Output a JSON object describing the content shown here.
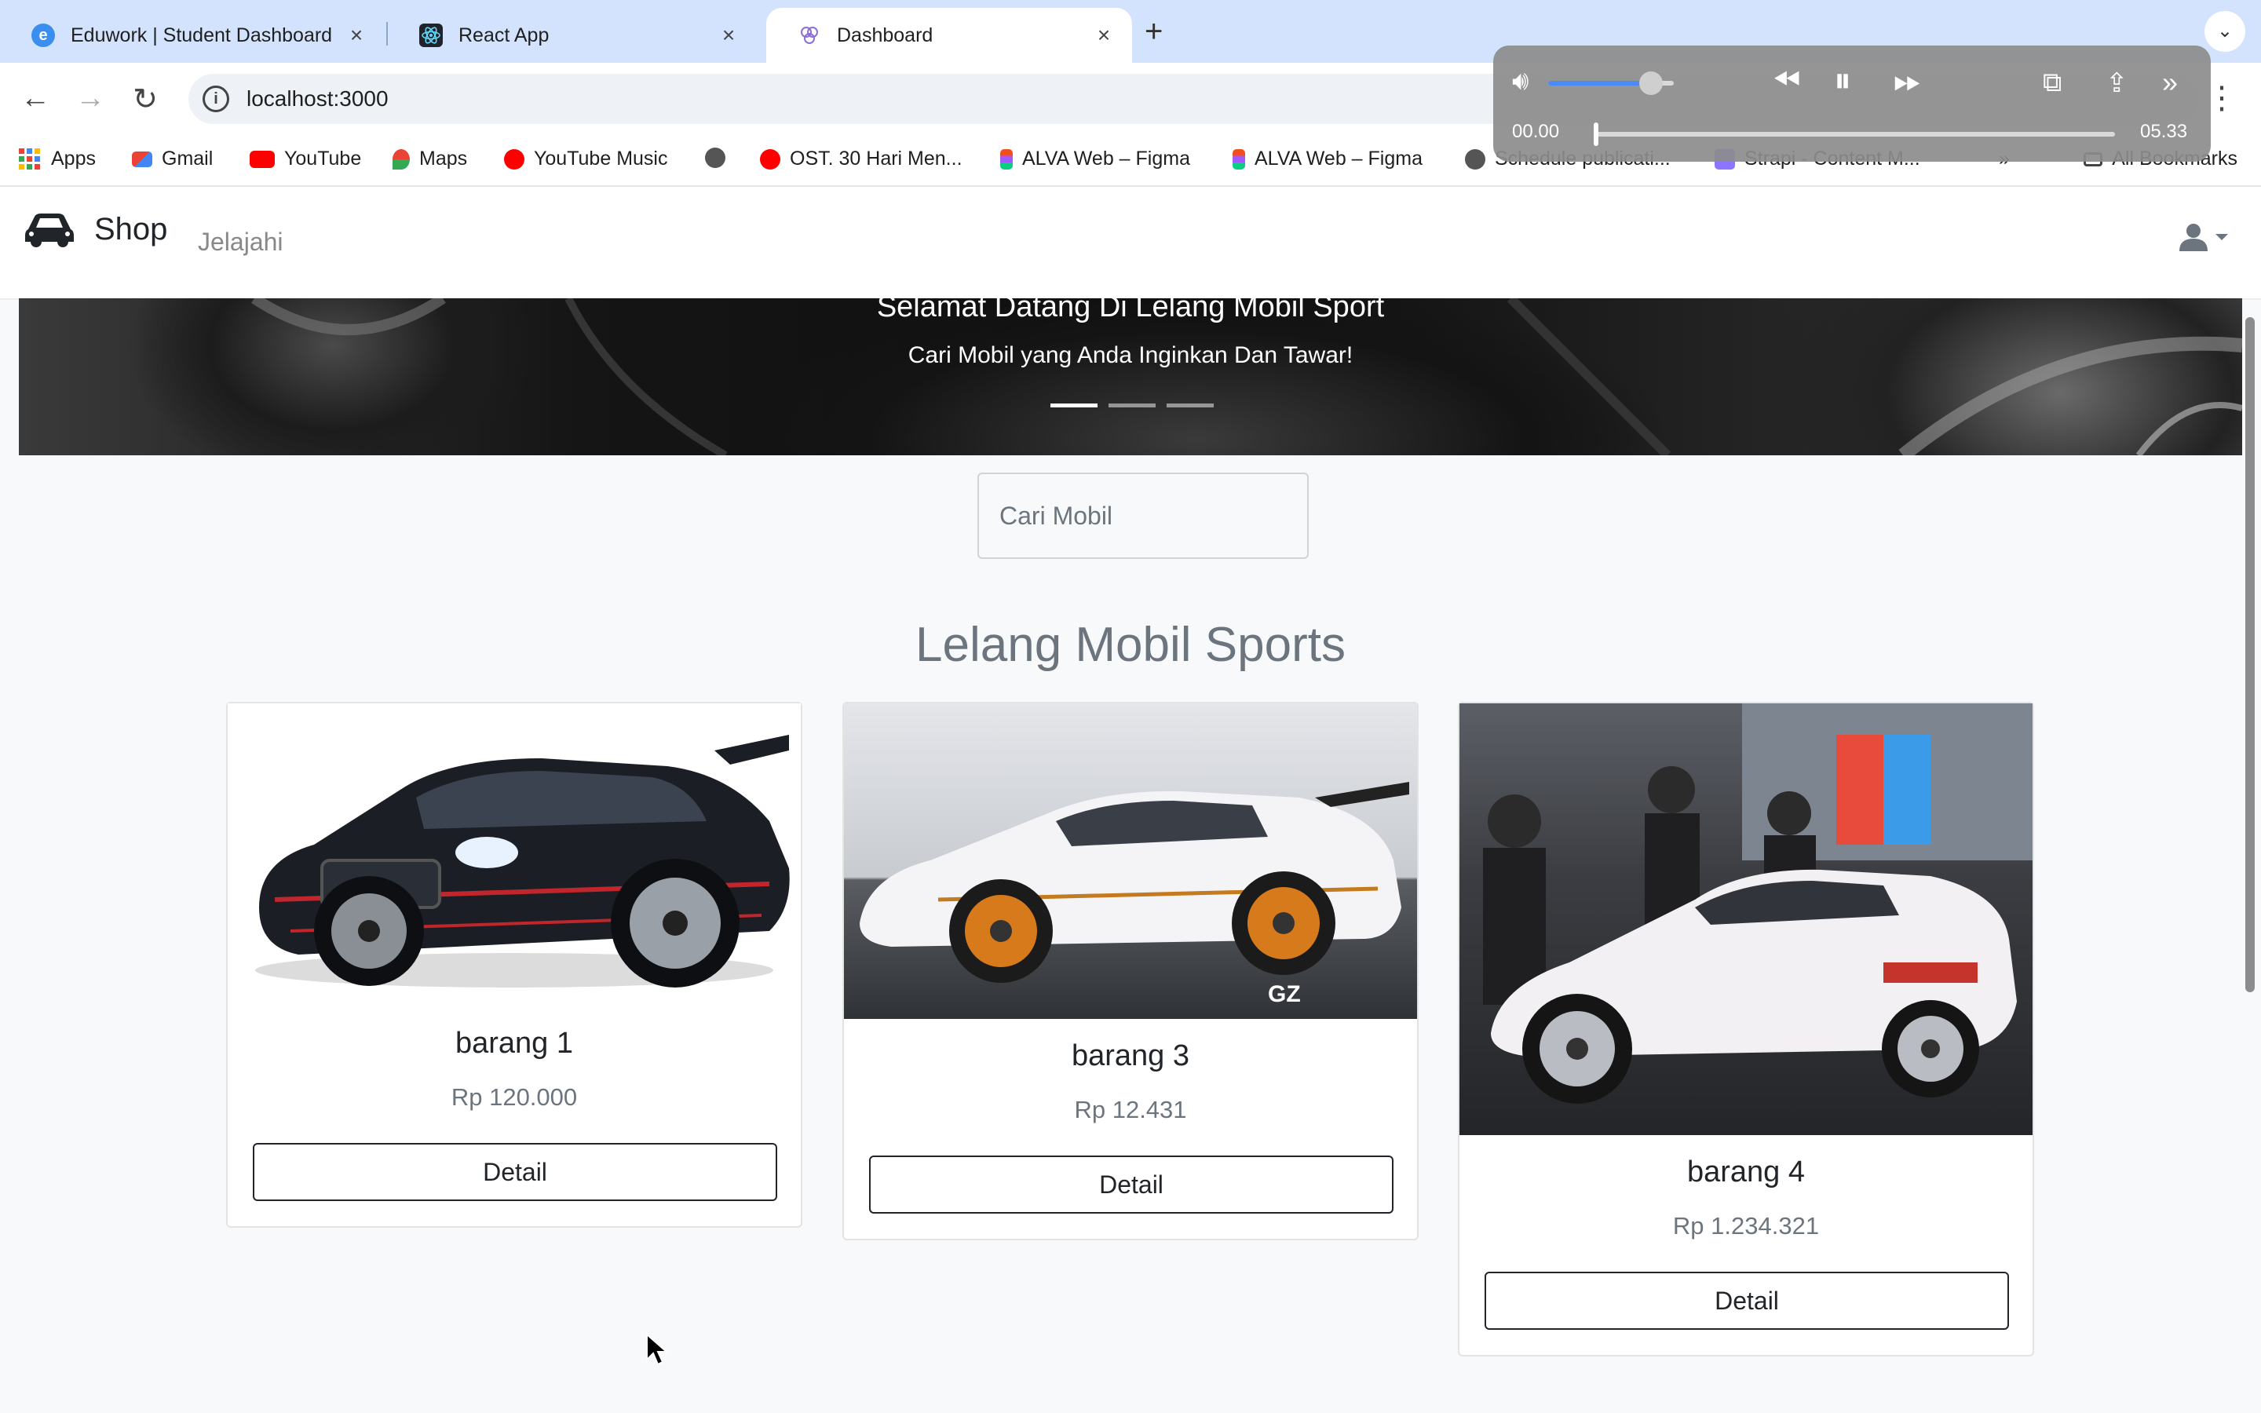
{
  "browser": {
    "tabs": [
      {
        "title": "Eduwork | Student Dashboard",
        "icon": "eduwork-icon",
        "active": false
      },
      {
        "title": "React App",
        "icon": "react-icon",
        "active": false
      },
      {
        "title": "Dashboard",
        "icon": "dashboard-icon",
        "active": true
      }
    ],
    "new_tab": "+",
    "url": "localhost:3000",
    "bookmarks": [
      {
        "label": "Apps",
        "icon": "apps-grid-icon"
      },
      {
        "label": "Gmail",
        "icon": "gmail-icon"
      },
      {
        "label": "YouTube",
        "icon": "youtube-icon"
      },
      {
        "label": "Maps",
        "icon": "maps-icon"
      },
      {
        "label": "YouTube Music",
        "icon": "youtube-music-icon"
      },
      {
        "label": "",
        "icon": "globe-icon"
      },
      {
        "label": "OST. 30 Hari Men...",
        "icon": "youtube-music-icon"
      },
      {
        "label": "ALVA Web – Figma",
        "icon": "figma-icon"
      },
      {
        "label": "ALVA Web – Figma",
        "icon": "figma-icon"
      },
      {
        "label": "Schedule publicati...",
        "icon": "globe-icon"
      },
      {
        "label": "Strapi - Content M...",
        "icon": "strapi-icon"
      }
    ],
    "bookmarks_overflow": "»",
    "all_bookmarks": "All Bookmarks"
  },
  "media": {
    "time_current": "00.00",
    "time_total": "05.33",
    "volume_level": 0.82,
    "progress": 0.0
  },
  "app": {
    "brand": "Shop",
    "nav_link": "Jelajahi",
    "hero": {
      "title": "Selamat Datang Di Lelang Mobil Sport",
      "subtitle": "Cari Mobil yang Anda Inginkan Dan Tawar!",
      "slides": 3,
      "active_slide": 0
    },
    "search_placeholder": "Cari Mobil",
    "section_title": "Lelang Mobil Sports",
    "products": [
      {
        "name": "barang 1",
        "price": "Rp 120.000",
        "button": "Detail",
        "image": "black-sport-car-image"
      },
      {
        "name": "barang 3",
        "price": "Rp 12.431",
        "button": "Detail",
        "image": "white-lamborghini-image"
      },
      {
        "name": "barang 4",
        "price": "Rp 1.234.321",
        "button": "Detail",
        "image": "white-lamborghini-showroom-image"
      }
    ]
  },
  "colors": {
    "tabstrip": "#d3e3fd",
    "page_bg": "#f8f9fa",
    "muted_text": "#6c757d",
    "dark_text": "#212529"
  }
}
